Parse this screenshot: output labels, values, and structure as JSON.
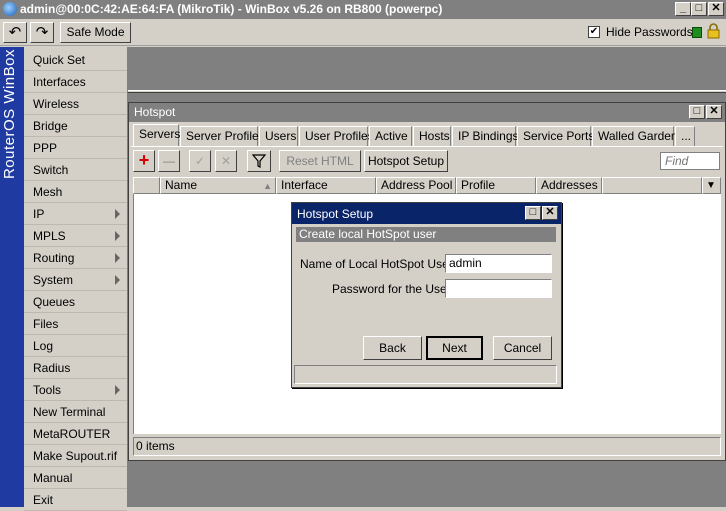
{
  "window": {
    "title": "admin@00:0C:42:AE:64:FA (MikroTik) - WinBox v5.26 on RB800 (powerpc)",
    "btn_min": "_",
    "btn_max": "□",
    "btn_close": "✕"
  },
  "toolbar": {
    "undo": "↶",
    "redo": "↷",
    "safe_mode": "Safe Mode",
    "hide_passwords_label": "Hide Passwords",
    "hide_passwords_checked": true,
    "check_mark": "✔"
  },
  "brand": {
    "vertical_text": "RouterOS WinBox"
  },
  "menu": {
    "items": [
      {
        "label": "Quick Set"
      },
      {
        "label": "Interfaces"
      },
      {
        "label": "Wireless"
      },
      {
        "label": "Bridge"
      },
      {
        "label": "PPP"
      },
      {
        "label": "Switch"
      },
      {
        "label": "Mesh"
      },
      {
        "label": "IP"
      },
      {
        "label": "MPLS"
      },
      {
        "label": "Routing"
      },
      {
        "label": "System"
      },
      {
        "label": "Queues"
      },
      {
        "label": "Files"
      },
      {
        "label": "Log"
      },
      {
        "label": "Radius"
      },
      {
        "label": "Tools"
      },
      {
        "label": "New Terminal"
      },
      {
        "label": "MetaROUTER"
      },
      {
        "label": "Make Supout.rif"
      },
      {
        "label": "Manual"
      },
      {
        "label": "Exit"
      }
    ]
  },
  "hotspot": {
    "title": "Hotspot",
    "tabs": [
      "Servers",
      "Server Profiles",
      "Users",
      "User Profiles",
      "Active",
      "Hosts",
      "IP Bindings",
      "Service Ports",
      "Walled Garden",
      "..."
    ],
    "active_tab": "Servers",
    "toolbar": {
      "add": "+",
      "remove": "—",
      "enable": "✓",
      "disable": "✕",
      "filter": "▼",
      "reset_html": "Reset HTML",
      "hotspot_setup": "Hotspot Setup",
      "find_placeholder": "Find"
    },
    "columns": [
      "Name",
      "Interface",
      "Address Pool",
      "Profile",
      "Addresses ..."
    ],
    "sort_indicator": "▲",
    "dropdown": "▼",
    "status": "0 items"
  },
  "dialog": {
    "title": "Hotspot Setup",
    "section": "Create local HotSpot user",
    "name_label": "Name of Local HotSpot User:",
    "name_value": "admin",
    "password_label": "Password for the User:",
    "password_value": "",
    "back": "Back",
    "next": "Next",
    "cancel": "Cancel"
  },
  "colors": {
    "accent_blue": "#1f3aa0",
    "dialog_title": "#0a246a",
    "title_bar": "#808080",
    "add_red": "#d40000"
  }
}
